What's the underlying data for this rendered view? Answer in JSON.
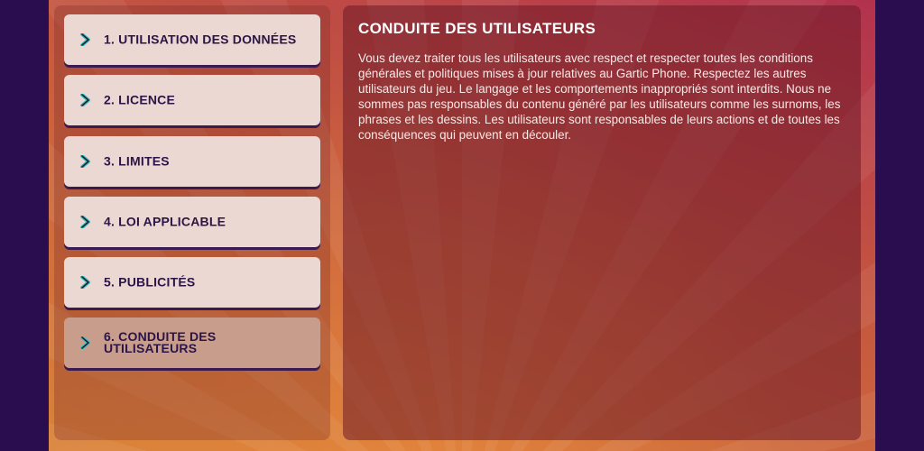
{
  "menu": {
    "items": [
      {
        "label": "1. UTILISATION DES DONNÉES",
        "active": false
      },
      {
        "label": "2. LICENCE",
        "active": false
      },
      {
        "label": "3. LIMITES",
        "active": false
      },
      {
        "label": "4. LOI APPLICABLE",
        "active": false
      },
      {
        "label": "5. PUBLICITÉS",
        "active": false
      },
      {
        "label": "6. CONDUITE DES UTILISATEURS",
        "active": true
      }
    ]
  },
  "content": {
    "title": "CONDUITE DES UTILISATEURS",
    "body": "Vous devez traiter tous les utilisateurs avec respect et respecter toutes les conditions générales et politiques mises à jour relatives au Gartic Phone. Respectez les autres utilisateurs du jeu. Le langage et les comportements inappropriés sont interdits. Nous ne sommes pas responsables du contenu généré par les utilisateurs comme les surnoms, les phrases et les dessins. Les utilisateurs sont responsables de leurs actions et de toutes les conséquences qui peuvent en découler."
  },
  "icons": {
    "menu_item_icon": "chevron-right-icon"
  },
  "colors": {
    "background": "#2a0d4f",
    "item_bg": "#ecd8d3",
    "item_active_bg": "#c99d8c",
    "item_text": "#2b1546",
    "chevron_fill": "#2b1546",
    "chevron_stroke": "#33c9b4"
  }
}
